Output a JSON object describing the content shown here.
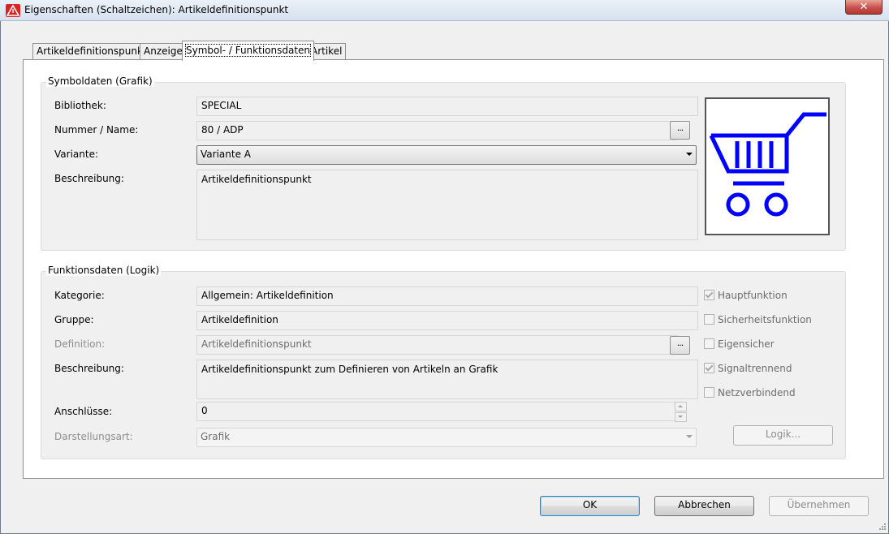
{
  "window": {
    "title": "Eigenschaften (Schaltzeichen): Artikeldefinitionspunkt",
    "close_glyph": "✕"
  },
  "tabs": [
    {
      "label": "Artikeldefinitionspunkt"
    },
    {
      "label": "Anzeige"
    },
    {
      "label": "Symbol- / Funktionsdaten"
    },
    {
      "label": "Artikel"
    }
  ],
  "symbol": {
    "group_title": "Symboldaten (Grafik)",
    "library_label": "Bibliothek:",
    "library_value": "SPECIAL",
    "number_label": "Nummer / Name:",
    "number_value": "80 / ADP",
    "browse_label": "...",
    "variant_label": "Variante:",
    "variant_value": "Variante A",
    "description_label": "Beschreibung:",
    "description_value": "Artikeldefinitionspunkt",
    "preview_icon": "shopping-cart-icon",
    "preview_color": "#0000ff"
  },
  "function": {
    "group_title": "Funktionsdaten (Logik)",
    "category_label": "Kategorie:",
    "category_value": "Allgemein: Artikeldefinition",
    "group_label": "Gruppe:",
    "group_value": "Artikeldefinition",
    "definition_label": "Definition:",
    "definition_value": "Artikeldefinitionspunkt",
    "browse_label": "...",
    "description_label": "Beschreibung:",
    "description_value": "Artikeldefinitionspunkt zum Definieren von Artikeln an Grafik",
    "connections_label": "Anschlüsse:",
    "connections_value": "0",
    "display_label": "Darstellungsart:",
    "display_value": "Grafik",
    "checkboxes": [
      {
        "label": "Hauptfunktion",
        "checked": true
      },
      {
        "label": "Sicherheitsfunktion",
        "checked": false
      },
      {
        "label": "Eigensicher",
        "checked": false
      },
      {
        "label": "Signaltrennend",
        "checked": true
      },
      {
        "label": "Netzverbindend",
        "checked": false
      }
    ],
    "logic_button": "Logik..."
  },
  "footer": {
    "ok": "OK",
    "cancel": "Abbrechen",
    "apply": "Übernehmen"
  }
}
